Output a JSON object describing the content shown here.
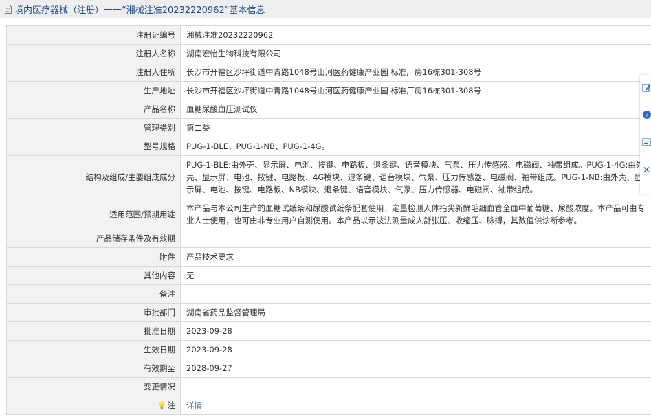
{
  "header": {
    "category": "境内医疗器械（注册）",
    "separator": "——",
    "cert_title": "“湘械注准20232220962”",
    "suffix": "基本信息"
  },
  "rows": [
    {
      "label": "注册证编号",
      "value": "湘械注准20232220962"
    },
    {
      "label": "注册人名称",
      "value": "湖南宏怡生物科技有限公司"
    },
    {
      "label": "注册人住所",
      "value": "长沙市开福区沙坪街道中青路1048号山河医药健康产业园 标准厂房16栋301-308号"
    },
    {
      "label": "生产地址",
      "value": "长沙市开福区沙坪街道中青路1048号山河医药健康产业园 标准厂房16栋301-308号"
    },
    {
      "label": "产品名称",
      "value": "血糖尿酸血压测试仪"
    },
    {
      "label": "管理类别",
      "value": "第二类"
    },
    {
      "label": "型号规格",
      "value": "PUG-1-BLE、PUG-1-NB、PUG-1-4G。"
    },
    {
      "label": "结构及组成/主要组成成分",
      "value": "PUG-1-BLE:由外壳、显示屏、电池、按键、电路板、退条键、语音模块、气泵、压力传感器、电磁阀、袖带组成。PUG-1-4G:由外壳、显示屏、电池、按键、电路板、4G模块、退条键、语音模块、气泵、压力传感器、电磁阀、袖带组成。PUG-1-NB:由外壳、显示屏、电池、按键、电路板、NB模块、退条键、语音模块、气泵、压力传感器、电磁阀、袖带组成。"
    },
    {
      "label": "适用范围/预期用途",
      "value": "本产品与本公司生产的血糖试纸条和尿酸试纸条配套使用，定量检测人体指尖新鲜毛细血管全血中葡萄糖、尿酸浓度。本产品可由专业人士使用，也可由非专业用户自测使用。本产品以示波法测量成人舒张压、收缩压、脉搏，其数值供诊断参考。"
    },
    {
      "label": "产品储存条件及有效期",
      "value": ""
    },
    {
      "label": "附件",
      "value": "产品技术要求"
    },
    {
      "label": "其他内容",
      "value": "无"
    },
    {
      "label": "备注",
      "value": ""
    },
    {
      "label": "审批部门",
      "value": "湖南省药品监督管理局"
    },
    {
      "label": "批准日期",
      "value": "2023-09-28"
    },
    {
      "label": "生效日期",
      "value": "2023-09-28"
    },
    {
      "label": "有效期至",
      "value": "2028-09-27"
    },
    {
      "label": "变更情况",
      "value": ""
    },
    {
      "label": "注",
      "value": "详情"
    }
  ]
}
